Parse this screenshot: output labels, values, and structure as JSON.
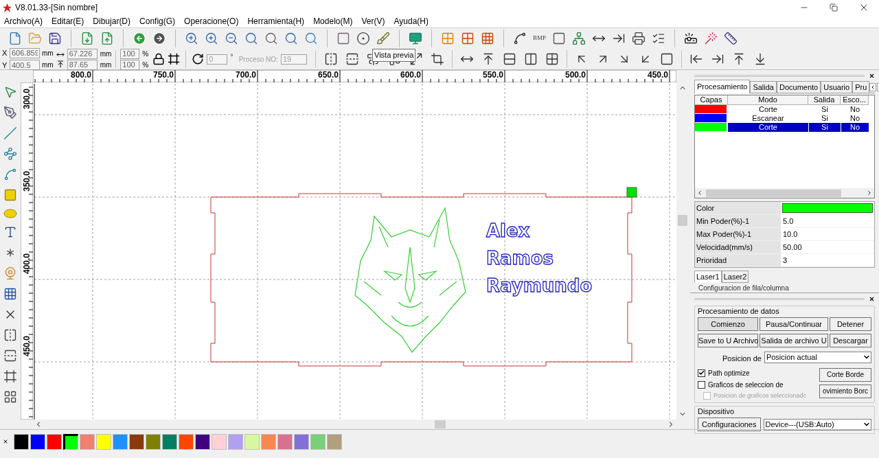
{
  "window": {
    "title": "V8.01.33-[Sin nombre]"
  },
  "menu": [
    "Archivo(A)",
    "Editar(E)",
    "Dibujar(D)",
    "Config(G)",
    "Operacione(O)",
    "Herramienta(H)",
    "Modelo(M)",
    "Ver(V)",
    "Ayuda(H)"
  ],
  "toolbar": {
    "bmp_label": "BMP",
    "tooltip": "Vista previa"
  },
  "coordinates": {
    "position": [
      {
        "axis": "X",
        "value": "606.859",
        "unit": "mm"
      },
      {
        "axis": "Y",
        "value": "400.5",
        "unit": "mm"
      }
    ],
    "size": [
      {
        "value": "67.226",
        "unit": "mm"
      },
      {
        "value": "87.65",
        "unit": "mm"
      }
    ],
    "scale": [
      {
        "value": "100",
        "unit": "%"
      },
      {
        "value": "100",
        "unit": "%"
      }
    ],
    "rotation": {
      "value": "0",
      "unit": "°",
      "disabled": true
    },
    "process": {
      "label": "Proceso NO:",
      "value": "19",
      "disabled": true
    }
  },
  "rulers": {
    "horizontal": [
      "800.0",
      "750.0",
      "700.0",
      "650.0",
      "600.0",
      "550.0",
      "500.0",
      "450.0"
    ],
    "vertical": [
      "300.0",
      "350.0",
      "400.0",
      "450.0"
    ]
  },
  "canvas": {
    "texts": [
      "Alex",
      "Ramos",
      "Raymundo"
    ]
  },
  "panel": {
    "tabs": [
      {
        "label": "Procesamiento",
        "selected": true
      },
      {
        "label": "Salida",
        "selected": false
      },
      {
        "label": "Documento",
        "selected": false
      },
      {
        "label": "Usuario",
        "selected": false
      },
      {
        "label": "Pru",
        "selected": false
      }
    ],
    "layers": {
      "columns": [
        "Capas",
        "Modo",
        "Salida",
        "Esco..."
      ],
      "rows": [
        {
          "color": "#ff0000",
          "mode": "Corte",
          "output": "Si",
          "column_4": "No",
          "selected": false
        },
        {
          "color": "#0000ff",
          "mode": "Escanear",
          "output": "Si",
          "column_4": "No",
          "selected": false
        },
        {
          "color": "#00ff00",
          "mode": "Corte",
          "output": "Si",
          "column_4": "No",
          "selected": true
        }
      ]
    },
    "properties": [
      {
        "label": "Color",
        "kind": "color",
        "color": "#00ff00"
      },
      {
        "label": "Min Poder(%)-1",
        "kind": "text",
        "value": "5.0"
      },
      {
        "label": "Max Poder(%)-1",
        "kind": "text",
        "value": "10.0"
      },
      {
        "label": "Velocidad(mm/s)",
        "kind": "text",
        "value": "50.00"
      },
      {
        "label": "Prioridad",
        "kind": "text",
        "value": "3"
      }
    ],
    "laser_tabs": [
      {
        "label": "Laser1",
        "selected": true
      },
      {
        "label": "Laser2",
        "selected": false
      }
    ],
    "group_title": "Configuracion de fila/columna"
  },
  "processing": {
    "title": "Procesamiento de datos",
    "buttons": [
      "Comienzo",
      "Pausa/Continuar",
      "Detener",
      "Save to U Archivo",
      "Salida de archivo U",
      "Descargar"
    ],
    "position_label": "Posicion de",
    "position_value": "Posicion actual",
    "options": [
      {
        "label": "Path optimize",
        "checked": true,
        "disabled": false
      },
      {
        "label": "Graficos de seleccion de",
        "checked": false,
        "disabled": false
      },
      {
        "label": "Posicion de graficos seleccionadc",
        "checked": false,
        "disabled": true
      }
    ],
    "side_buttons": [
      "Corte Borde",
      "ovimiento Borc"
    ]
  },
  "device": {
    "title": "Dispositivo",
    "button": "Configuraciones",
    "value": "Device---(USB:Auto)"
  },
  "palette": [
    {
      "color": "#000000",
      "selected": false
    },
    {
      "color": "#0000ff",
      "selected": false
    },
    {
      "color": "#ff0000",
      "selected": false
    },
    {
      "color": "#00ff00",
      "selected": true
    },
    {
      "color": "#f08070",
      "selected": false
    },
    {
      "color": "#ffff00",
      "selected": false
    },
    {
      "color": "#1e90ff",
      "selected": false
    },
    {
      "color": "#8b3a0f",
      "selected": false
    },
    {
      "color": "#808000",
      "selected": false
    },
    {
      "color": "#008060",
      "selected": false
    },
    {
      "color": "#ff4500",
      "selected": false
    },
    {
      "color": "#400080",
      "selected": false
    },
    {
      "color": "#ffd0d8",
      "selected": false
    },
    {
      "color": "#b0a0f0",
      "selected": false
    },
    {
      "color": "#d8f8a0",
      "selected": false
    },
    {
      "color": "#f88850",
      "selected": false
    },
    {
      "color": "#d87090",
      "selected": false
    },
    {
      "color": "#8070d8",
      "selected": false
    },
    {
      "color": "#78d078",
      "selected": false
    },
    {
      "color": "#b0a080",
      "selected": false
    }
  ]
}
